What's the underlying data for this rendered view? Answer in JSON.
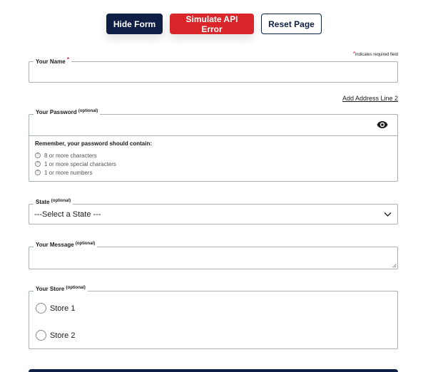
{
  "buttons": {
    "hide_form": "Hide Form",
    "simulate_error": "Simulate API Error",
    "reset_page": "Reset Page"
  },
  "required_note": {
    "star": "*",
    "text": "indicates required field"
  },
  "name_field": {
    "label": "Your Name",
    "required_mark": "*"
  },
  "address_link": "Add Address Line 2",
  "password_field": {
    "label": "Your Password",
    "optional": "(optional)",
    "rules_title": "Remember, your password should contain:",
    "rules": [
      "8 or more characters",
      "1 or more special characters",
      "1 or more numbers"
    ],
    "icon": "eye-icon"
  },
  "state_field": {
    "label": "State",
    "optional": "(optional)",
    "selected": "---Select a State ---"
  },
  "message_field": {
    "label": "Your Message",
    "optional": "(optional)"
  },
  "store_field": {
    "label": "Your Store",
    "optional": "(optional)",
    "options": [
      "Store 1",
      "Store 2"
    ]
  },
  "colors": {
    "navy": "#0f1e45",
    "red": "#d9262b",
    "border": "#a8b0b8"
  }
}
